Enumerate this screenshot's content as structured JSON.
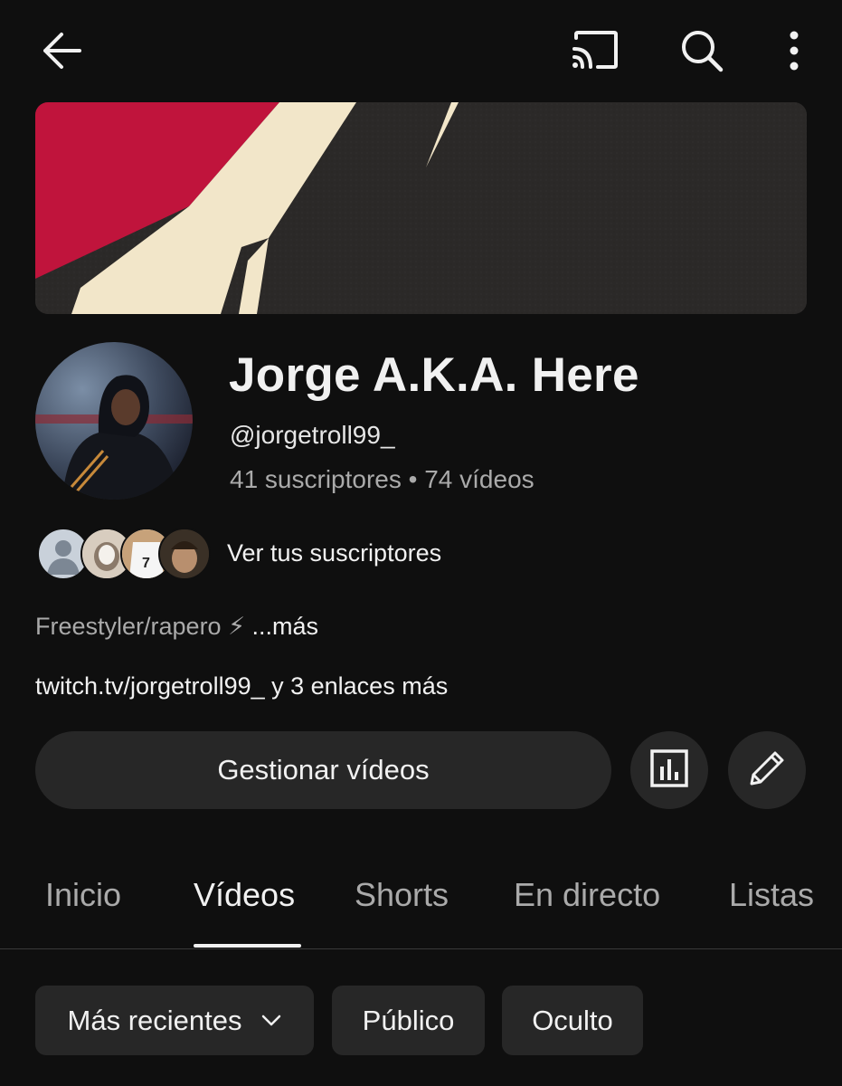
{
  "topbar": {
    "back_icon": "arrow-back-icon",
    "cast_icon": "cast-icon",
    "search_icon": "search-icon",
    "more_icon": "more-vert-icon"
  },
  "channel": {
    "name": "Jorge A.K.A. Here",
    "handle": "@jorgetroll99_",
    "stats": "41 suscriptores • 74 vídeos",
    "view_subscribers": "Ver tus suscriptores",
    "description": "Freestyler/rapero ⚡",
    "description_more": "...más",
    "links": "twitch.tv/jorgetroll99_ y 3 enlaces más"
  },
  "actions": {
    "manage_label": "Gestionar vídeos",
    "stats_icon": "analytics-icon",
    "edit_icon": "pencil-icon"
  },
  "tabs": [
    {
      "label": "Inicio",
      "active": false
    },
    {
      "label": "Vídeos",
      "active": true
    },
    {
      "label": "Shorts",
      "active": false
    },
    {
      "label": "En directo",
      "active": false
    },
    {
      "label": "Listas",
      "active": false
    }
  ],
  "filters": {
    "sort_label": "Más recientes",
    "public_label": "Público",
    "hidden_label": "Oculto"
  },
  "colors": {
    "background": "#0f0f0f",
    "chip": "#272727",
    "banner_red": "#c0143c",
    "banner_cream": "#f2e6c9"
  }
}
